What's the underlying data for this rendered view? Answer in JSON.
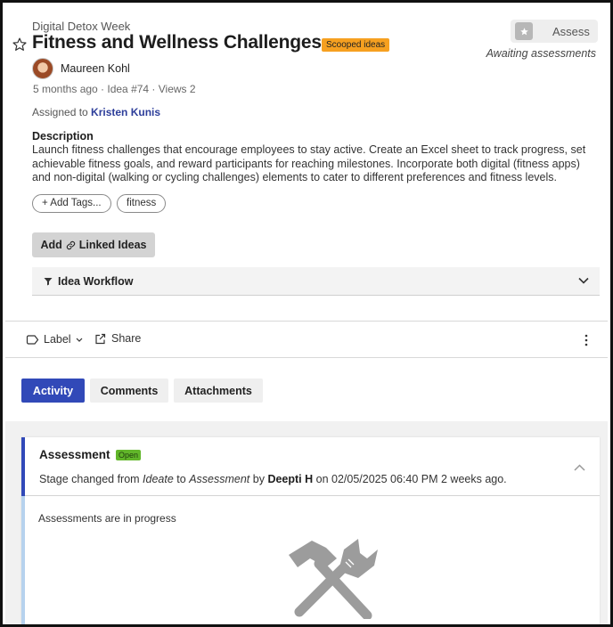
{
  "idea": {
    "campaign": "Digital Detox Week",
    "title": "Fitness and Wellness Challenges",
    "status_badge": "Scooped ideas",
    "author": "Maureen Kohl",
    "meta": "5 months ago · Idea #74 · Views 2",
    "assigned_prefix": "Assigned to ",
    "assigned_name": "Kristen Kunis",
    "description_heading": "Description",
    "description": "Launch fitness challenges that encourage employees to stay active. Create an Excel sheet to track progress, set achievable fitness goals, and reward participants for reaching milestones. Incorporate both digital (fitness apps) and non-digital (walking or cycling challenges) elements to cater to different preferences and fitness levels."
  },
  "assess": {
    "button_label": "Assess",
    "status": "Awaiting assessments"
  },
  "tags": {
    "add_label": "+ Add Tags...",
    "items": [
      "fitness"
    ]
  },
  "linked_ideas": {
    "label_add": "Add",
    "label_rest": "Linked Ideas"
  },
  "workflow": {
    "title": "Idea Workflow"
  },
  "actions": {
    "label": "Label",
    "share": "Share"
  },
  "tabs": [
    {
      "label": "Activity",
      "active": true
    },
    {
      "label": "Comments",
      "active": false
    },
    {
      "label": "Attachments",
      "active": false
    }
  ],
  "activity": {
    "card_title": "Assessment",
    "badge": "Open",
    "desc_1": "Stage changed from ",
    "from_stage": "Ideate",
    "desc_2": " to ",
    "to_stage": "Assessment",
    "desc_3": " by ",
    "actor": "Deepti H",
    "desc_4": " on 02/05/2025 06:40 PM 2 weeks ago.",
    "progress_text": "Assessments are in progress"
  },
  "colors": {
    "primary": "#3149b8",
    "status_badge_bg": "#f6a020",
    "open_badge_bg": "#61b62a",
    "assignee_link": "#2d3e9a"
  },
  "icons": [
    "star-icon",
    "assess-star-icon",
    "avatar",
    "link-icon",
    "filter-icon",
    "chevron-down-icon",
    "label-icon",
    "share-icon",
    "more-vertical-icon",
    "chevron-up-icon",
    "tools-icon"
  ]
}
